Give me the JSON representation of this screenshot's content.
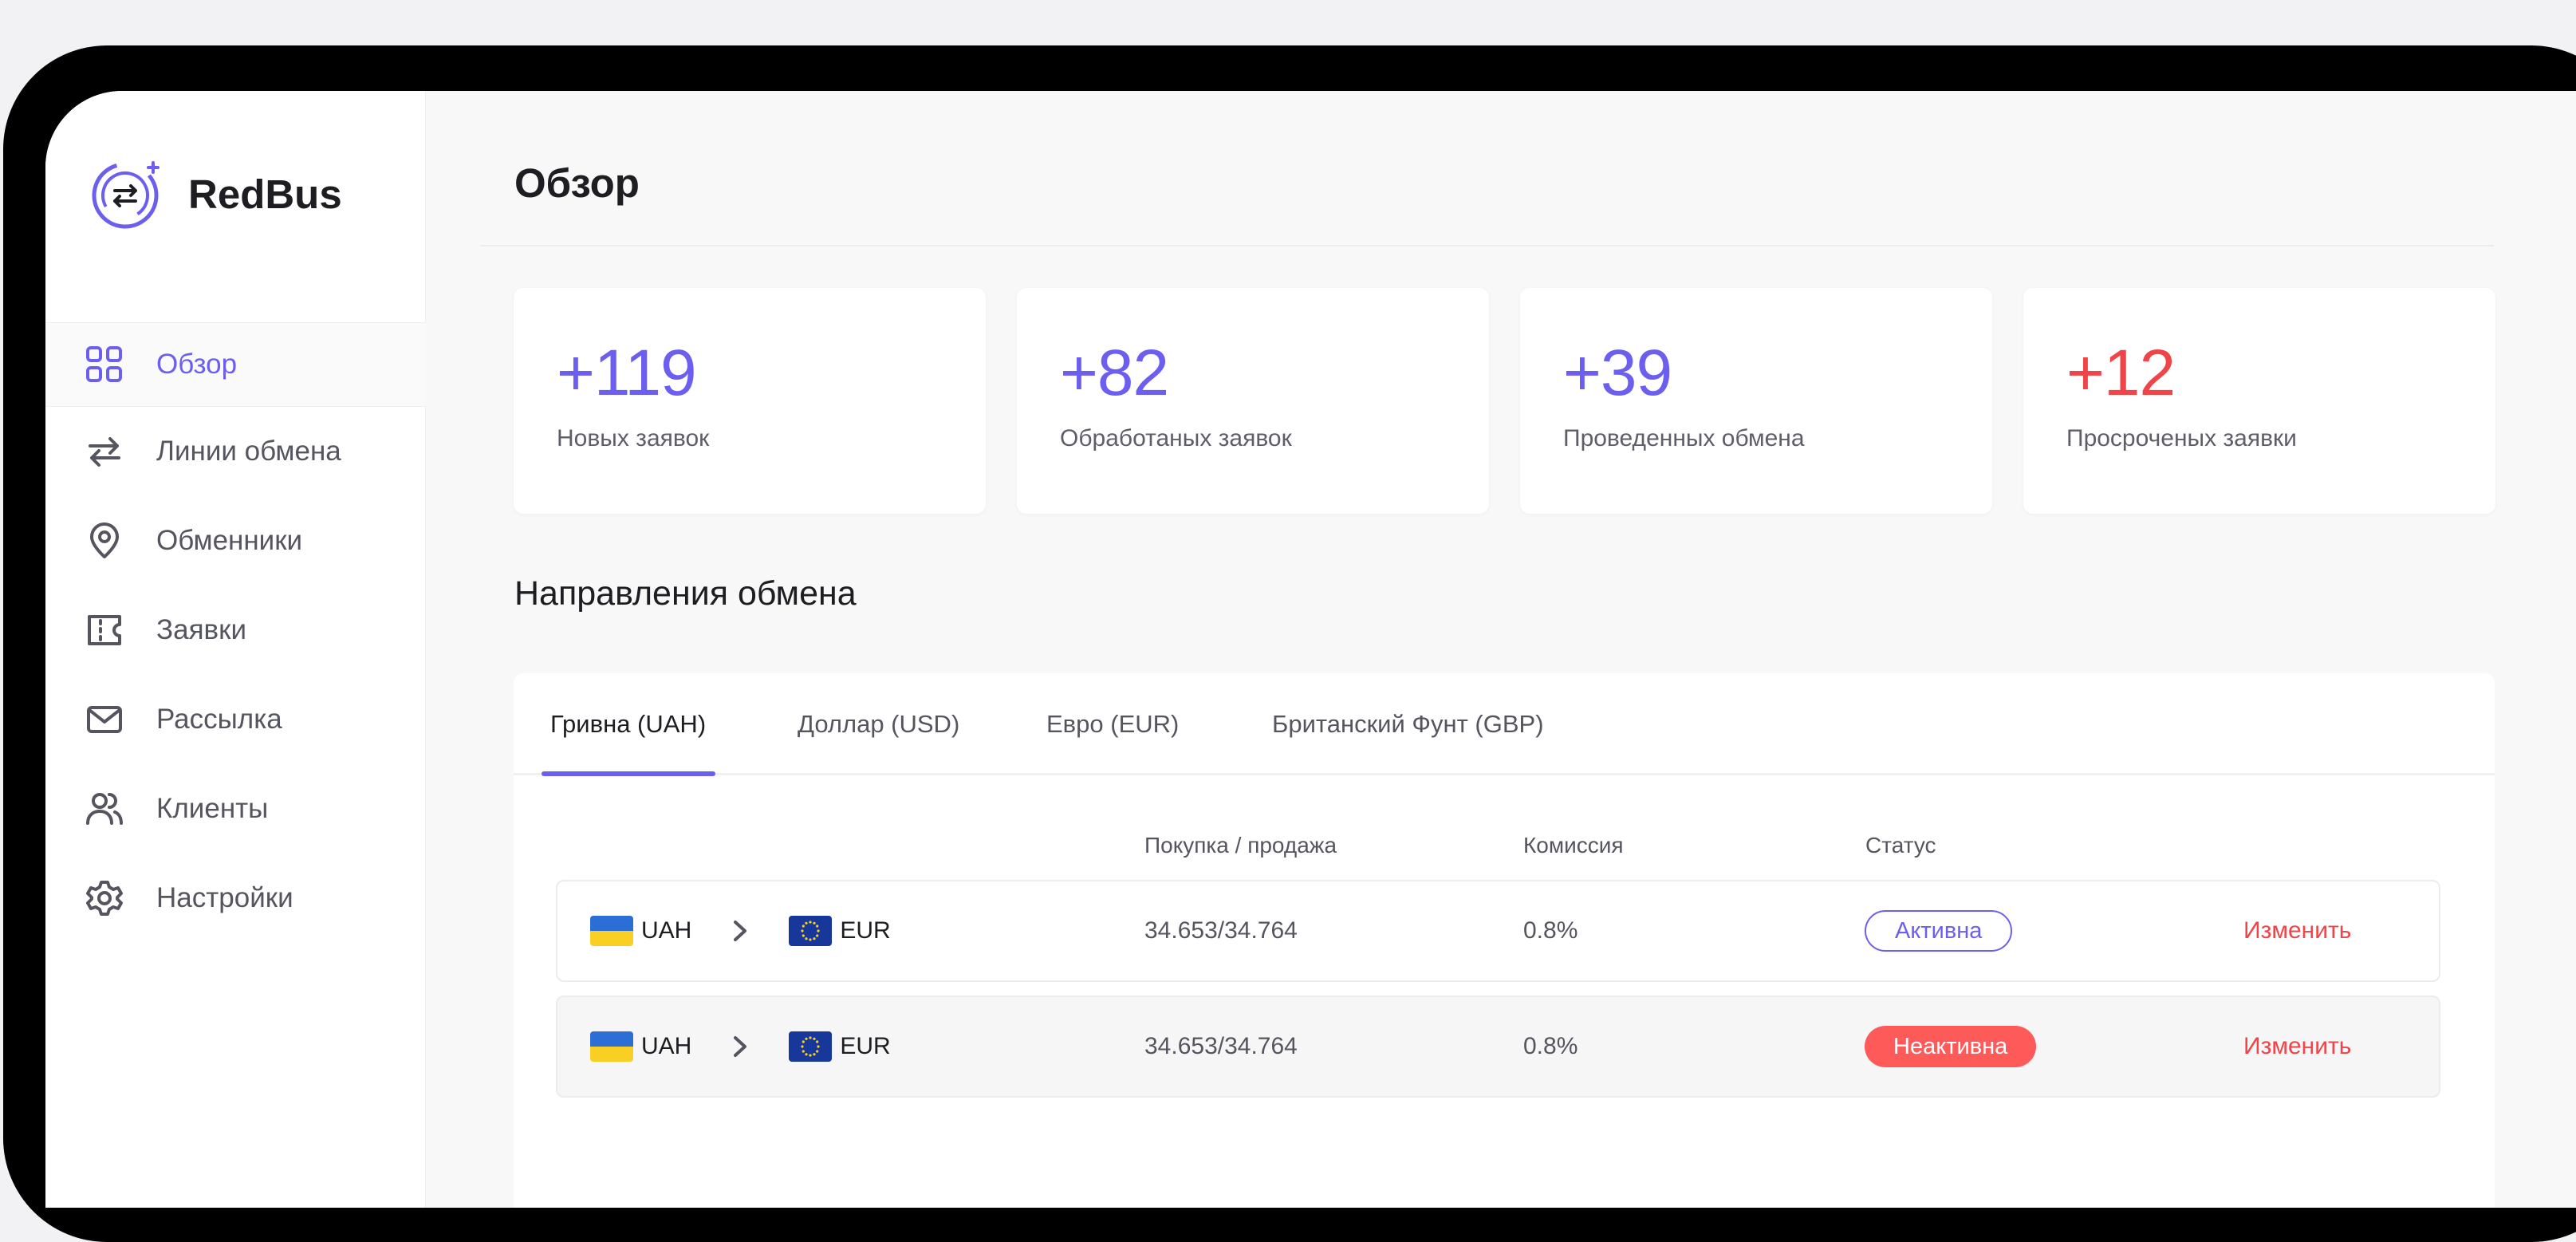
{
  "app": {
    "name": "RedBus"
  },
  "sidebar": {
    "items": [
      {
        "label": "Обзор",
        "icon": "dashboard-grid-icon",
        "active": true
      },
      {
        "label": "Линии обмена",
        "icon": "swap-arrows-icon"
      },
      {
        "label": "Обменники",
        "icon": "location-pin-icon"
      },
      {
        "label": "Заявки",
        "icon": "ticket-icon"
      },
      {
        "label": "Рассылка",
        "icon": "envelope-icon"
      },
      {
        "label": "Клиенты",
        "icon": "users-icon"
      },
      {
        "label": "Настройки",
        "icon": "gear-icon"
      }
    ]
  },
  "header": {
    "title": "Обзор"
  },
  "stats": [
    {
      "value": "+119",
      "label": "Новых заявок",
      "color": "#6c5ff0"
    },
    {
      "value": "+82",
      "label": "Обработаных заявок",
      "color": "#6c5ff0"
    },
    {
      "value": "+39",
      "label": "Проведенных обмена",
      "color": "#6c5ff0"
    },
    {
      "value": "+12",
      "label": "Просроченых заявки",
      "color": "#f04448"
    }
  ],
  "exchange": {
    "title": "Направления обмена",
    "tabs": [
      {
        "label": "Гривна (UAH)",
        "active": true
      },
      {
        "label": "Доллар (USD)"
      },
      {
        "label": "Евро (EUR)"
      },
      {
        "label": "Британский Фунт (GBP)"
      }
    ],
    "columns": {
      "rate": "Покупка / продажа",
      "commission": "Комиссия",
      "status": "Статус"
    },
    "rows": [
      {
        "from": "UAH",
        "to": "EUR",
        "rate": "34.653/34.764",
        "commission": "0.8%",
        "status": "Активна",
        "action": "Изменить"
      },
      {
        "from": "UAH",
        "to": "EUR",
        "rate": "34.653/34.764",
        "commission": "0.8%",
        "status": "Неактивна",
        "action": "Изменить"
      }
    ]
  },
  "colors": {
    "accent": "#6c5ff0",
    "danger": "#f04448",
    "badge_inactive": "#ff5a5a"
  }
}
